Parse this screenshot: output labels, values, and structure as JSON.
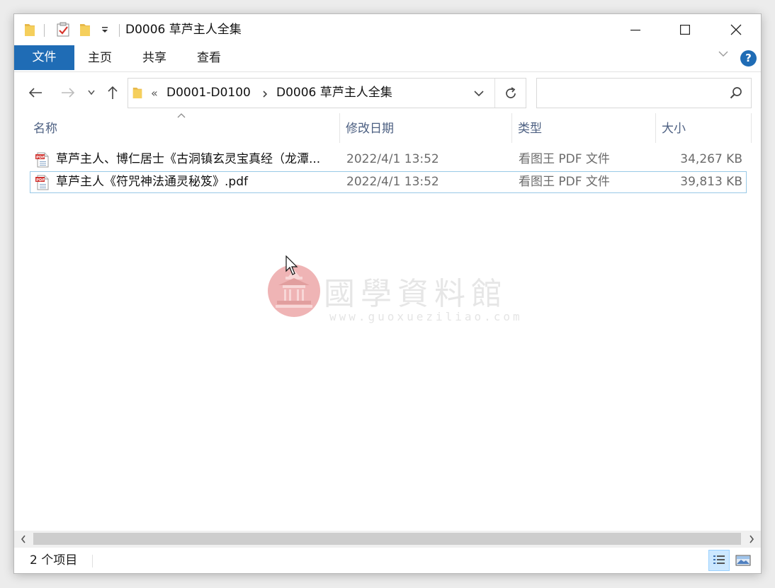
{
  "window": {
    "title": "D0006 草芦主人全集",
    "quick_access_icons": [
      "folder-icon",
      "properties-check-icon",
      "new-folder-icon",
      "customize-dropdown-icon"
    ],
    "caption_buttons": [
      "minimize",
      "maximize",
      "close"
    ]
  },
  "ribbon": {
    "file_tab": "文件",
    "tabs": [
      "主页",
      "共享",
      "查看"
    ],
    "help_label": "?"
  },
  "navigation": {
    "breadcrumb_overflow": "«",
    "breadcrumb": [
      "D0001-D0100",
      "D0006 草芦主人全集"
    ],
    "search_placeholder": ""
  },
  "columns": {
    "name": "名称",
    "modified": "修改日期",
    "type": "类型",
    "size": "大小"
  },
  "files": [
    {
      "name": "草芦主人、博仁居士《古洞镇玄灵宝真经（龙潭...",
      "modified": "2022/4/1 13:52",
      "type": "看图王 PDF 文件",
      "size": "34,267 KB"
    },
    {
      "name": "草芦主人《符咒神法通灵秘笈》.pdf",
      "modified": "2022/4/1 13:52",
      "type": "看图王 PDF 文件",
      "size": "39,813 KB"
    }
  ],
  "watermark": {
    "title": "國學資料館",
    "url": "www.guoxueziliao.com"
  },
  "status": {
    "item_count": "2 个项目"
  },
  "colors": {
    "accent": "#1f6cb5",
    "selection_border": "#99c9e6",
    "header_text": "#4d6082",
    "pdf_red": "#d0312d"
  }
}
